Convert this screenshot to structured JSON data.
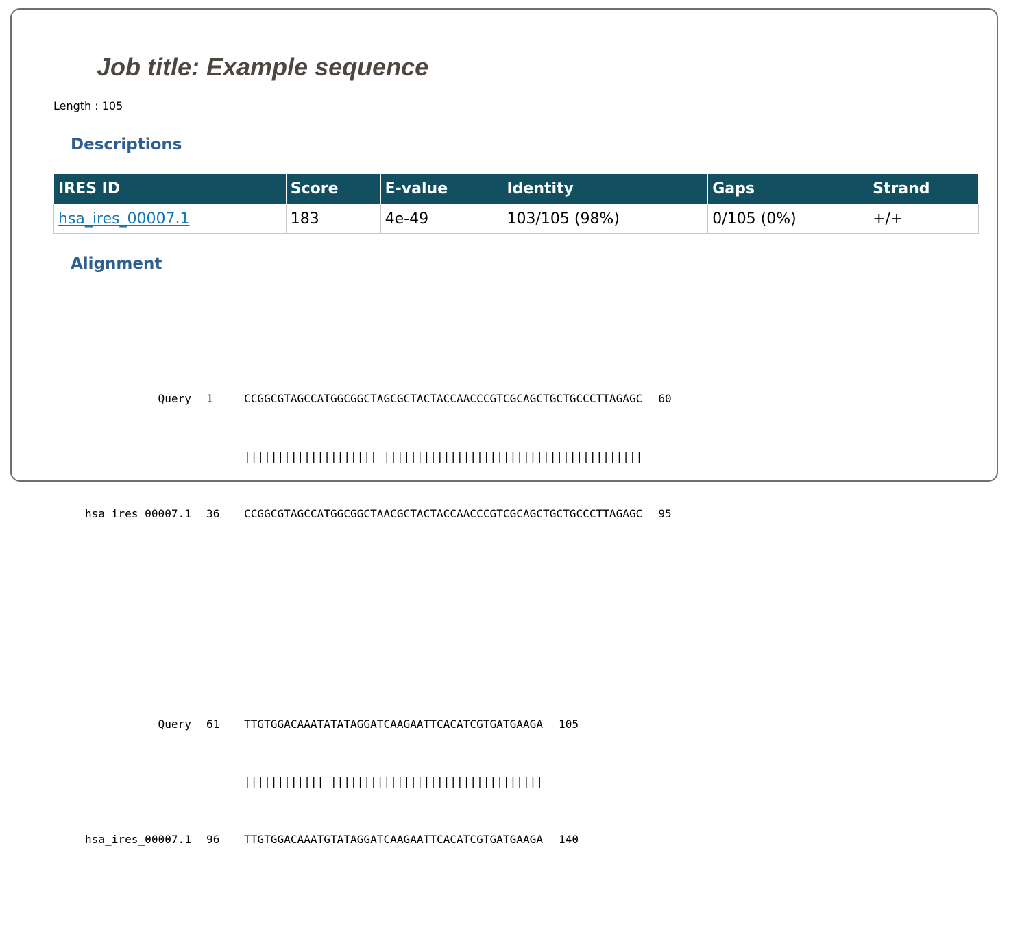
{
  "job": {
    "title": "Job title: Example sequence",
    "length_text": "Length : 105"
  },
  "sections": {
    "descriptions": "Descriptions",
    "alignment": "Alignment"
  },
  "table": {
    "headers": [
      "IRES ID",
      "Score",
      "E-value",
      "Identity",
      "Gaps",
      "Strand"
    ],
    "rows": [
      {
        "ires_id": "hsa_ires_00007.1",
        "score": "183",
        "evalue": "4e-49",
        "identity": "103/105 (98%)",
        "gaps": "0/105 (0%)",
        "strand": "+/+"
      }
    ]
  },
  "alignment": {
    "blocks": [
      {
        "query_label": "Query",
        "query_start": "1",
        "query_seq": "CCGGCGTAGCCATGGCGGCTAGCGCTACTACCAACCCGTCGCAGCTGCTGCCCTTAGAGC",
        "query_end": "60",
        "match_line": "|||||||||||||||||||| |||||||||||||||||||||||||||||||||||||||",
        "subject_label": "hsa_ires_00007.1",
        "subject_start": "36",
        "subject_seq": "CCGGCGTAGCCATGGCGGCTAACGCTACTACCAACCCGTCGCAGCTGCTGCCCTTAGAGC",
        "subject_end": "95"
      },
      {
        "query_label": "Query",
        "query_start": "61",
        "query_seq": "TTGTGGACAAATATATAGGATCAAGAATTCACATCGTGATGAAGA",
        "query_end": "105",
        "match_line": "|||||||||||| ||||||||||||||||||||||||||||||||",
        "subject_label": "hsa_ires_00007.1",
        "subject_start": "96",
        "subject_seq": "TTGTGGACAAATGTATAGGATCAAGAATTCACATCGTGATGAAGA",
        "subject_end": "140"
      }
    ]
  },
  "colors": {
    "title": "#4d4742",
    "heading": "#2f5f8f",
    "table_header_bg": "#124f60",
    "link": "#1577b2"
  }
}
